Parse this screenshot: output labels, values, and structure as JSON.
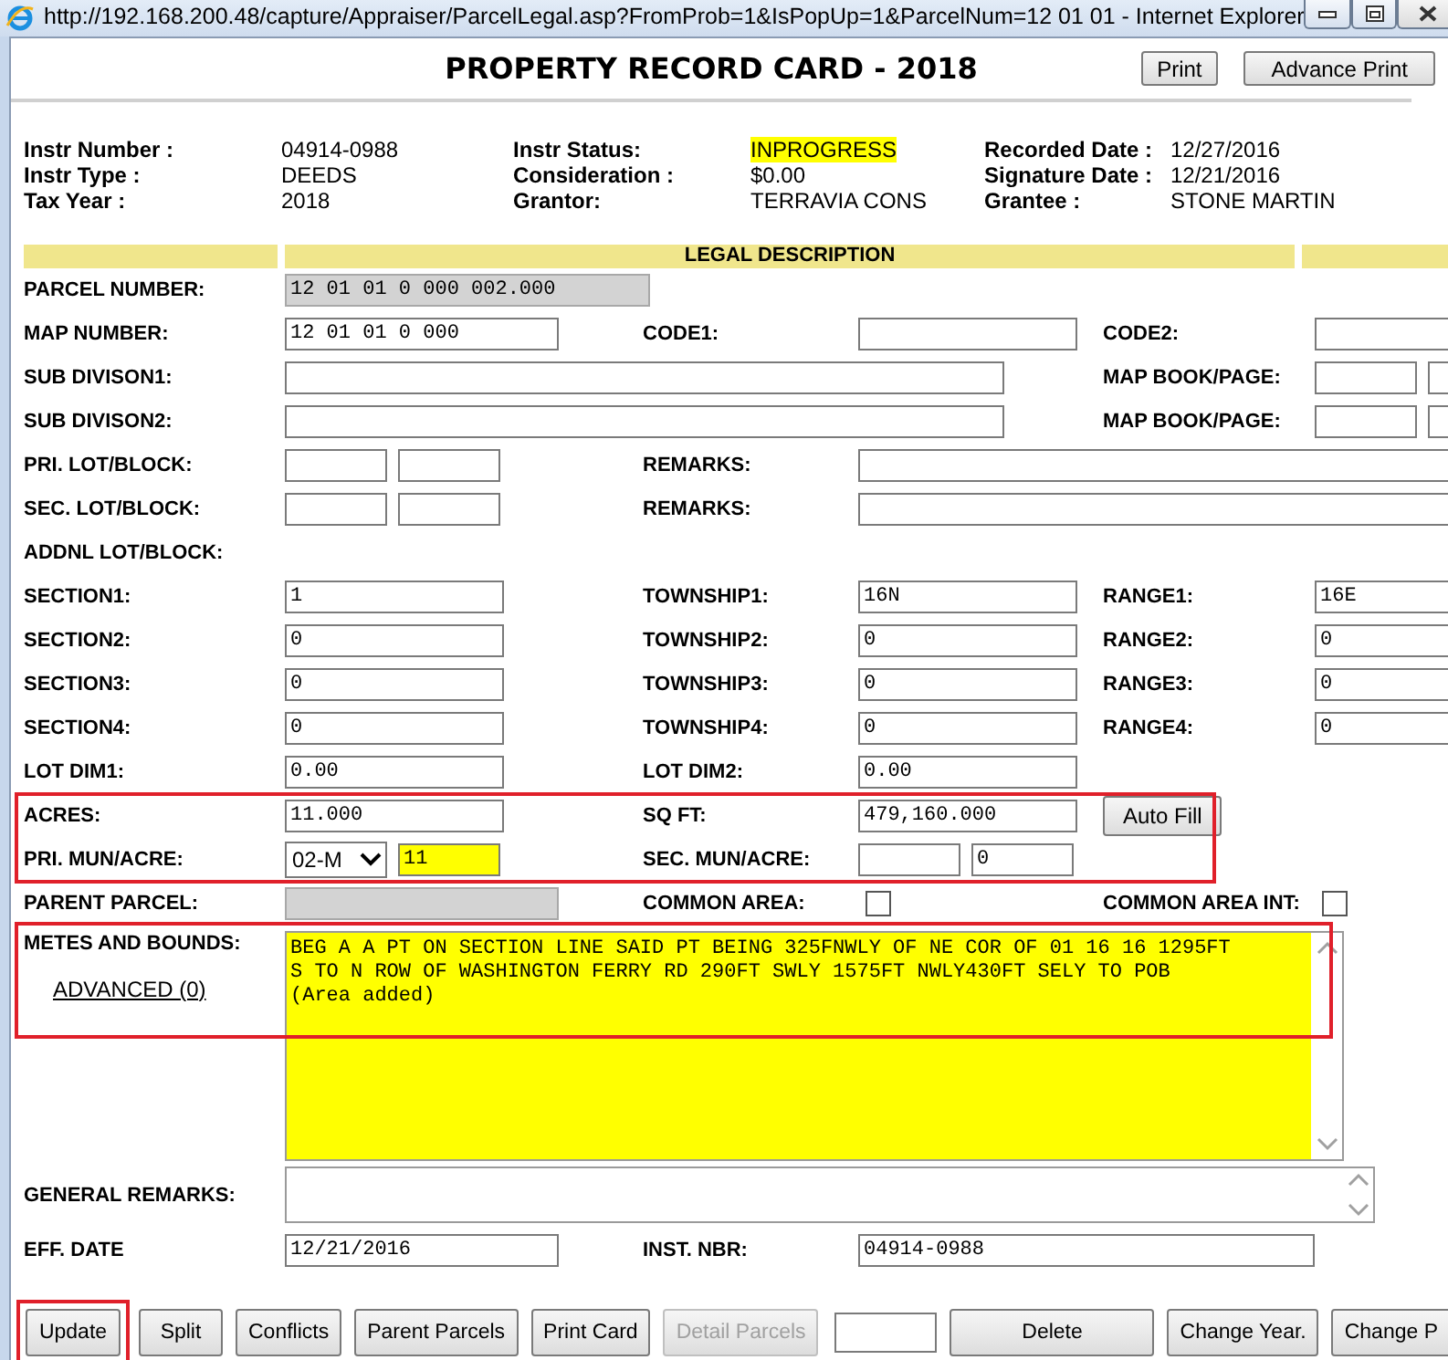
{
  "window": {
    "title": "http://192.168.200.48/capture/Appraiser/ParcelLegal.asp?FromProb=1&IsPopUp=1&ParcelNum=12 01 01 - Internet Explorer"
  },
  "header": {
    "title": "PROPERTY RECORD CARD - 2018",
    "buttons": [
      "Print",
      "Advance Print"
    ]
  },
  "info": [
    {
      "pairs": [
        {
          "label": "Instr Number :",
          "value": "04914-0988",
          "highlighted": false
        },
        {
          "label": "Instr Status:",
          "value": "INPROGRESS",
          "highlighted": true
        },
        {
          "label": "Recorded Date :",
          "value": "12/27/2016",
          "highlighted": false
        }
      ]
    },
    {
      "pairs": [
        {
          "label": "Instr Type :",
          "value": "DEEDS",
          "highlighted": false
        },
        {
          "label": "Consideration :",
          "value": "$0.00",
          "highlighted": false
        },
        {
          "label": "Signature Date :",
          "value": "12/21/2016",
          "highlighted": false
        }
      ]
    },
    {
      "pairs": [
        {
          "label": "Tax Year :",
          "value": "2018",
          "highlighted": false
        },
        {
          "label": "Grantor:",
          "value": "TERRAVIA CONS",
          "highlighted": false
        },
        {
          "label": "Grantee :",
          "value": "STONE MARTIN",
          "highlighted": false
        }
      ]
    }
  ],
  "legal_header": "LEGAL DESCRIPTION",
  "blocks": [
    {
      "rows": [
        {
          "sections": [
            {
              "label": "PARCEL NUMBER:",
              "controls": [
                {
                  "kind": "xl",
                  "value": "12 01 01 0 000 002.000",
                  "readonly": true,
                  "highlighted": false
                }
              ]
            }
          ]
        },
        {
          "sections": [
            {
              "label": "MAP NUMBER:",
              "controls": [
                {
                  "kind": "long",
                  "value": "12 01 01 0 000",
                  "readonly": false,
                  "highlighted": false
                }
              ]
            },
            {
              "label": "CODE1:",
              "controls": [
                {
                  "kind": "text",
                  "readonly": false,
                  "highlighted": false
                }
              ]
            },
            {
              "label": "CODE2:",
              "controls": [
                {
                  "kind": "text",
                  "readonly": false,
                  "highlighted": false
                }
              ]
            }
          ]
        },
        {
          "sections": [
            {
              "label": "SUB DIVISON1:",
              "controls": [
                {
                  "kind": "wide",
                  "readonly": false,
                  "highlighted": false
                }
              ]
            },
            {
              "label": "MAP BOOK/PAGE:",
              "controls": [
                {
                  "kind": "small",
                  "readonly": false,
                  "highlighted": false
                },
                {
                  "kind": "small",
                  "readonly": false,
                  "highlighted": false
                }
              ]
            }
          ]
        },
        {
          "sections": [
            {
              "label": "SUB DIVISON2:",
              "controls": [
                {
                  "kind": "wide",
                  "readonly": false,
                  "highlighted": false
                }
              ]
            },
            {
              "label": "MAP BOOK/PAGE:",
              "controls": [
                {
                  "kind": "small",
                  "readonly": false,
                  "highlighted": false
                },
                {
                  "kind": "small",
                  "readonly": false,
                  "highlighted": false
                }
              ]
            }
          ]
        },
        {
          "sections": [
            {
              "label": "PRI. LOT/BLOCK:",
              "controls": [
                {
                  "kind": "small",
                  "readonly": false,
                  "highlighted": false
                },
                {
                  "kind": "small",
                  "readonly": false,
                  "highlighted": false
                }
              ]
            },
            {
              "label": "REMARKS:",
              "controls": [
                {
                  "kind": "full",
                  "readonly": false,
                  "highlighted": false
                }
              ]
            }
          ]
        },
        {
          "sections": [
            {
              "label": "SEC. LOT/BLOCK:",
              "controls": [
                {
                  "kind": "small",
                  "readonly": false,
                  "highlighted": false
                },
                {
                  "kind": "small",
                  "readonly": false,
                  "highlighted": false
                }
              ]
            },
            {
              "label": "REMARKS:",
              "controls": [
                {
                  "kind": "full",
                  "readonly": false,
                  "highlighted": false
                }
              ]
            }
          ]
        },
        {
          "sections": [
            {
              "label": "ADDNL LOT/BLOCK:"
            }
          ]
        },
        {
          "sections": [
            {
              "label": "SECTION1:",
              "controls": [
                {
                  "kind": "text",
                  "value": "1",
                  "readonly": false,
                  "highlighted": false
                }
              ]
            },
            {
              "label": "TOWNSHIP1:",
              "controls": [
                {
                  "kind": "text",
                  "value": "16N",
                  "readonly": false,
                  "highlighted": false
                }
              ]
            },
            {
              "label": "RANGE1:",
              "controls": [
                {
                  "kind": "text",
                  "value": "16E",
                  "readonly": false,
                  "highlighted": false
                }
              ]
            }
          ]
        },
        {
          "sections": [
            {
              "label": "SECTION2:",
              "controls": [
                {
                  "kind": "text",
                  "value": "0",
                  "readonly": false,
                  "highlighted": false
                }
              ]
            },
            {
              "label": "TOWNSHIP2:",
              "controls": [
                {
                  "kind": "text",
                  "value": "0",
                  "readonly": false,
                  "highlighted": false
                }
              ]
            },
            {
              "label": "RANGE2:",
              "controls": [
                {
                  "kind": "text",
                  "value": "0",
                  "readonly": false,
                  "highlighted": false
                }
              ]
            }
          ]
        },
        {
          "sections": [
            {
              "label": "SECTION3:",
              "controls": [
                {
                  "kind": "text",
                  "value": "0",
                  "readonly": false,
                  "highlighted": false
                }
              ]
            },
            {
              "label": "TOWNSHIP3:",
              "controls": [
                {
                  "kind": "text",
                  "value": "0",
                  "readonly": false,
                  "highlighted": false
                }
              ]
            },
            {
              "label": "RANGE3:",
              "controls": [
                {
                  "kind": "text",
                  "value": "0",
                  "readonly": false,
                  "highlighted": false
                }
              ]
            }
          ]
        },
        {
          "sections": [
            {
              "label": "SECTION4:",
              "controls": [
                {
                  "kind": "text",
                  "value": "0",
                  "readonly": false,
                  "highlighted": false
                }
              ]
            },
            {
              "label": "TOWNSHIP4:",
              "controls": [
                {
                  "kind": "text",
                  "value": "0",
                  "readonly": false,
                  "highlighted": false
                }
              ]
            },
            {
              "label": "RANGE4:",
              "controls": [
                {
                  "kind": "text",
                  "value": "0",
                  "readonly": false,
                  "highlighted": false
                }
              ]
            }
          ]
        },
        {
          "sections": [
            {
              "label": "LOT DIM1:",
              "controls": [
                {
                  "kind": "text",
                  "value": "0.00",
                  "readonly": false,
                  "highlighted": false
                }
              ]
            },
            {
              "label": "LOT DIM2:",
              "controls": [
                {
                  "kind": "text",
                  "value": "0.00",
                  "readonly": false,
                  "highlighted": false
                }
              ]
            }
          ]
        }
      ]
    },
    {
      "outlined": true,
      "rows": [
        {
          "sections": [
            {
              "label": "ACRES:",
              "controls": [
                {
                  "kind": "text",
                  "value": "11.000",
                  "readonly": false,
                  "highlighted": false
                }
              ]
            },
            {
              "label": "SQ FT:",
              "controls": [
                {
                  "kind": "text",
                  "value": "479,160.000",
                  "readonly": false,
                  "highlighted": false
                }
              ]
            },
            {
              "controls": [
                {
                  "kind": "button",
                  "value": "Auto Fill"
                }
              ]
            }
          ]
        },
        {
          "sections": [
            {
              "label": "PRI. MUN/ACRE:",
              "controls": [
                {
                  "kind": "select",
                  "value": "02-M"
                },
                {
                  "kind": "tiny",
                  "value": "11",
                  "readonly": false,
                  "highlighted": true
                }
              ]
            },
            {
              "label": "SEC. MUN/ACRE:",
              "controls": [
                {
                  "kind": "small",
                  "readonly": false,
                  "highlighted": false
                },
                {
                  "kind": "small",
                  "value": "0",
                  "readonly": false,
                  "highlighted": false
                }
              ]
            }
          ]
        }
      ]
    },
    {
      "rows": [
        {
          "sections": [
            {
              "label": "PARENT PARCEL:",
              "controls": [
                {
                  "kind": "long",
                  "readonly": true,
                  "highlighted": false
                }
              ]
            },
            {
              "label": "COMMON AREA:",
              "controls": [
                {
                  "kind": "checkbox",
                  "checked": false
                }
              ]
            },
            {
              "label": "COMMON AREA INT:",
              "controls": [
                {
                  "kind": "checkbox",
                  "checked": false
                }
              ]
            }
          ]
        }
      ]
    }
  ],
  "metes": {
    "label": "METES AND BOUNDS:",
    "link": "ADVANCED (0)",
    "outlined": true,
    "highlighted": true,
    "lines": [
      "BEG A A PT ON SECTION LINE SAID PT BEING 325FNWLY OF NE COR OF 01 16 16 1295FT",
      "S TO N ROW OF WASHINGTON FERRY RD 290FT SWLY 1575FT NWLY430FT SELY TO POB",
      "(Area added)"
    ]
  },
  "general_remarks": {
    "label": "GENERAL REMARKS:"
  },
  "eff": {
    "label": "EFF. DATE",
    "value": "12/21/2016",
    "label2": "INST. NBR:",
    "value2": "04914-0988"
  },
  "buttons": [
    {
      "kind": "button",
      "label": "Update",
      "disabled": false,
      "outlined": true
    },
    {
      "kind": "button",
      "label": "Split",
      "disabled": false
    },
    {
      "kind": "button",
      "label": "Conflicts",
      "disabled": false
    },
    {
      "kind": "button",
      "label": "Parent Parcels",
      "disabled": false
    },
    {
      "kind": "button",
      "label": "Print Card",
      "disabled": false
    },
    {
      "kind": "button",
      "label": "Detail Parcels",
      "disabled": true
    },
    {
      "kind": "field"
    },
    {
      "kind": "wide",
      "label": "Delete",
      "disabled": false
    },
    {
      "kind": "button",
      "label": "Change Year.",
      "disabled": false
    },
    {
      "kind": "button",
      "label": "Change P",
      "disabled": false
    }
  ]
}
